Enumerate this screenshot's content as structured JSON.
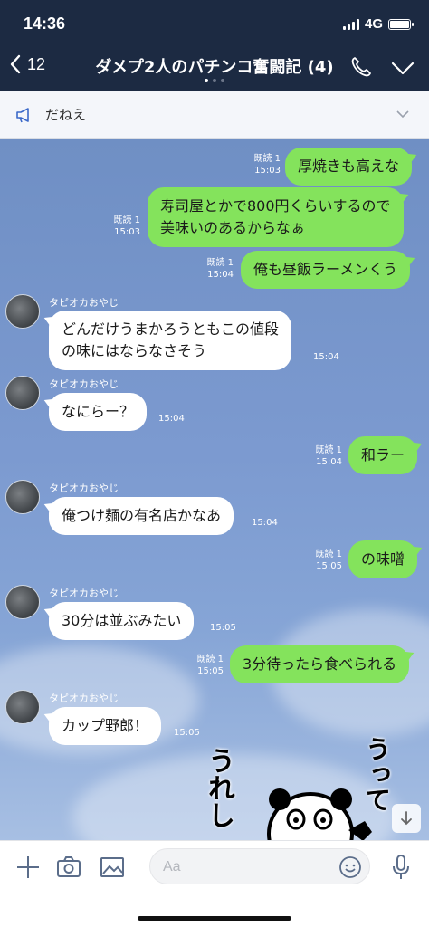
{
  "status_bar": {
    "time": "14:36",
    "network": "4G"
  },
  "header": {
    "back_count": "12",
    "title": "ダメプ2人のパチンコ奮闘記 (4)"
  },
  "announcement": {
    "text": "だねえ"
  },
  "messages": [
    {
      "side": "me",
      "text": "厚焼きも高えな",
      "read": "既読 1",
      "time": "15:03"
    },
    {
      "side": "me",
      "line1": "寿司屋とかで800円くらいするので",
      "line2": "美味いのあるからなぁ",
      "read": "既読 1",
      "time": "15:03"
    },
    {
      "side": "me",
      "text": "俺も昼飯ラーメンくう",
      "read": "既読 1",
      "time": "15:04"
    },
    {
      "side": "them",
      "sender": "タピオカおやじ",
      "line1": "どんだけうまかろうともこの値段",
      "line2": "の味にはならなさそう",
      "time": "15:04"
    },
    {
      "side": "them",
      "sender": "タピオカおやじ",
      "text": "なにらー？",
      "time": "15:04"
    },
    {
      "side": "me",
      "text": "和ラー",
      "read": "既読 1",
      "time": "15:04"
    },
    {
      "side": "them",
      "sender": "タピオカおやじ",
      "text": "俺つけ麺の有名店かなあ",
      "time": "15:04"
    },
    {
      "side": "me",
      "text": "の味噌",
      "read": "既読 1",
      "time": "15:05"
    },
    {
      "side": "them",
      "sender": "タピオカおやじ",
      "text": "30分は並ぶみたい",
      "time": "15:05"
    },
    {
      "side": "me",
      "text": "3分待ったら食べられる",
      "read": "既読 1",
      "time": "15:05"
    },
    {
      "side": "them",
      "sender": "タピオカおやじ",
      "text": "カップ野郎！",
      "time": "15:05"
    }
  ],
  "sticker": {
    "left_text": "うれし",
    "right_text": "うって"
  },
  "input": {
    "placeholder": "Aa"
  },
  "icons": {
    "back": "chevron-left-icon",
    "call": "phone-icon",
    "menu": "chevron-down-icon",
    "announce": "megaphone-icon",
    "plus": "plus-icon",
    "camera": "camera-icon",
    "image": "image-icon",
    "emoji": "emoji-icon",
    "mic": "microphone-icon",
    "scroll": "arrow-down-icon"
  },
  "colors": {
    "header_bg": "#1c2a42",
    "my_bubble": "#84e35c",
    "their_bubble": "#ffffff",
    "chat_bg": "#7c9ad0"
  }
}
